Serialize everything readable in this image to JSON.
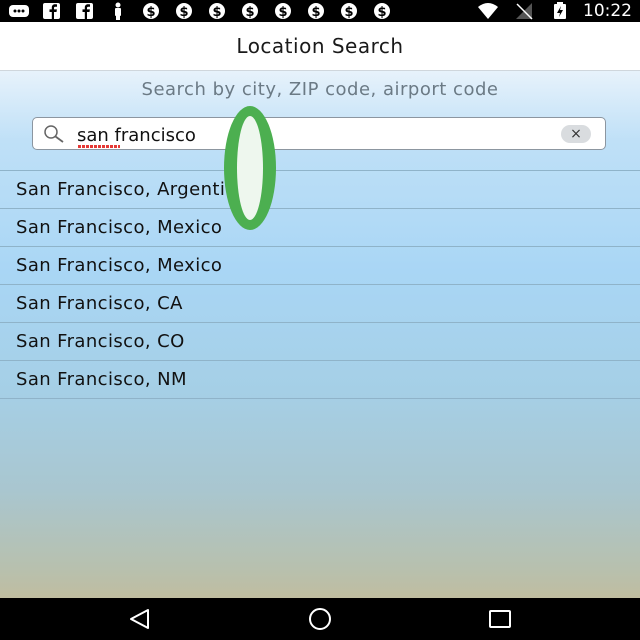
{
  "status_bar": {
    "time": "10:22",
    "left_icons": [
      "message-icon",
      "facebook-icon",
      "facebook-icon",
      "accessibility-icon",
      "dollar-icon",
      "dollar-icon",
      "dollar-icon",
      "dollar-icon",
      "dollar-icon",
      "dollar-icon",
      "dollar-icon",
      "dollar-icon"
    ],
    "right_icons": [
      "wifi-icon",
      "no-signal-icon",
      "battery-charging-icon"
    ]
  },
  "header": {
    "title": "Location Search"
  },
  "search": {
    "hint": "Search by city, ZIP code, airport code",
    "value": "san francisco",
    "clear_label": "×"
  },
  "results": [
    "San Francisco, Argentina",
    "San Francisco, Mexico",
    "San Francisco, Mexico",
    "San Francisco, CA",
    "San Francisco, CO",
    "San Francisco, NM"
  ],
  "colors": {
    "touch_indicator": "#4caf50",
    "spell_underline": "#e53935"
  }
}
